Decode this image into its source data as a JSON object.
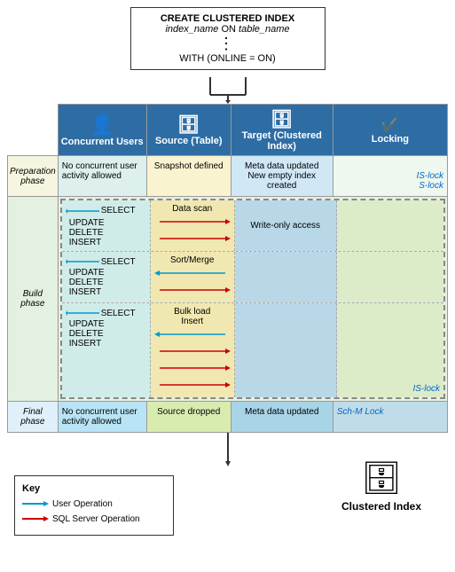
{
  "sql_box": {
    "line1": "CREATE CLUSTERED INDEX",
    "line2_italic": "index_name",
    "line2_normal": " ON ",
    "line2_italic2": "table_name",
    "dots": ":",
    "line3": "WITH (ONLINE = ON)"
  },
  "columns": {
    "concurrent": {
      "label": "Concurrent Users",
      "icon": "👤"
    },
    "source": {
      "label": "Source (Table)",
      "icon": "🗄"
    },
    "target": {
      "label": "Target (Clustered Index)",
      "icon": "🗄"
    },
    "locking": {
      "label": "Locking",
      "icon": "✔"
    }
  },
  "phases": {
    "prep": {
      "label": "Preparation phase",
      "concurrent": "No concurrent user activity allowed",
      "source": "Snapshot defined",
      "target": "Meta data updated\nNew empty index created",
      "locking": [
        "IS-lock",
        "S-lock"
      ]
    },
    "build": {
      "label": "Build phase",
      "sub_rows": [
        {
          "concurrent": [
            "SELECT",
            "UPDATE",
            "DELETE",
            "INSERT"
          ],
          "source_action": "Data scan",
          "target_action": "Write-only access",
          "locking": ""
        },
        {
          "concurrent": [
            "SELECT",
            "UPDATE",
            "DELETE",
            "INSERT"
          ],
          "source_action": "Sort/Merge",
          "target_action": "",
          "locking": ""
        },
        {
          "concurrent": [
            "SELECT",
            "UPDATE",
            "DELETE",
            "INSERT"
          ],
          "source_action": "Bulk load Insert",
          "target_action": "",
          "locking": "IS-lock"
        }
      ]
    },
    "final": {
      "label": "Final phase",
      "concurrent": "No concurrent user activity allowed",
      "source": "Source dropped",
      "target": "Meta data updated",
      "locking": "Sch-M Lock"
    }
  },
  "key": {
    "title": "Key",
    "items": [
      {
        "label": "User Operation",
        "color": "blue"
      },
      {
        "label": "SQL Server Operation",
        "color": "red"
      }
    ]
  },
  "bottom": {
    "icon": "🗄",
    "label": "Clustered Index"
  }
}
